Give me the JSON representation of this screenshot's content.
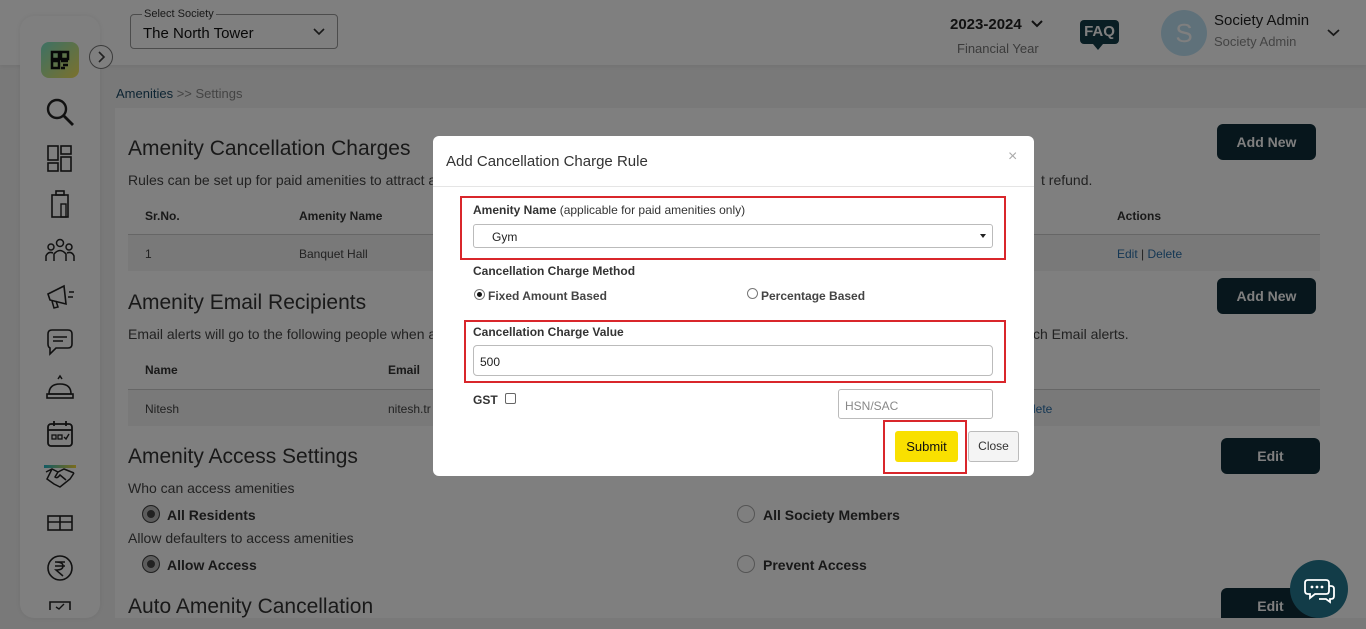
{
  "header": {
    "society_label": "Select Society",
    "society_value": "The North Tower",
    "financial_year": "2023-2024",
    "financial_year_label": "Financial Year",
    "faq_label": "FAQ",
    "avatar_letter": "S",
    "user_name": "Society Admin",
    "user_role": "Society Admin"
  },
  "sidebar": {
    "icons": [
      "logo-icon",
      "search-icon",
      "dashboard-icon",
      "building-icon",
      "members-icon",
      "announcement-icon",
      "chat-icon",
      "service-icon",
      "calendar-icon",
      "handshake-icon",
      "gift-icon",
      "rupee-icon",
      "more-icon"
    ],
    "active": "calendar-icon"
  },
  "breadcrumb": {
    "root": "Amenities",
    "sep": " >> ",
    "current": "Settings"
  },
  "sections": {
    "cancellation": {
      "title": "Amenity Cancellation Charges",
      "desc": "Rules can be set up for paid amenities to attract ad",
      "desc_tail": "t refund.",
      "add_label": "Add New",
      "headers": [
        "Sr.No.",
        "Amenity Name",
        "Actions"
      ],
      "row": {
        "sr": "1",
        "name": "Banquet Hall",
        "edit": "Edit",
        "sep": " | ",
        "delete": "Delete"
      }
    },
    "email": {
      "title": "Amenity Email Recipients",
      "desc": "Email alerts will go to the following people when ar",
      "desc_tail": "ch Email alerts.",
      "add_label": "Add New",
      "headers": [
        "Name",
        "Email"
      ],
      "row": {
        "name": "Nitesh",
        "email": "nitesh.tr",
        "action_tail": "lete"
      }
    },
    "access": {
      "title": "Amenity Access Settings",
      "edit_label": "Edit",
      "q1": "Who can access amenities",
      "q1_opt1": "All Residents",
      "q1_opt2": "All Society Members",
      "q2": "Allow defaulters to access amenities",
      "q2_opt1": "Allow Access",
      "q2_opt2": "Prevent Access"
    },
    "auto": {
      "title": "Auto Amenity Cancellation",
      "edit_label": "Edit"
    }
  },
  "modal": {
    "title": "Add Cancellation Charge Rule",
    "close_x": "×",
    "amenity_label": "Amenity Name",
    "amenity_hint": " (applicable for paid amenities only)",
    "amenity_value": "Gym",
    "method_label": "Cancellation Charge Method",
    "method_opt1": "Fixed Amount Based",
    "method_opt2": "Percentage Based",
    "method_selected": "Fixed Amount Based",
    "value_label": "Cancellation Charge Value",
    "value": "500",
    "gst_label": "GST",
    "gst_checked": false,
    "hsn_placeholder": "HSN/SAC",
    "submit_label": "Submit",
    "close_label": "Close"
  },
  "colors": {
    "primary_dark": "#0f2d38",
    "submit_yellow": "#f9e000",
    "highlight_red": "#d9262b",
    "link_blue": "#2a6fa8"
  }
}
